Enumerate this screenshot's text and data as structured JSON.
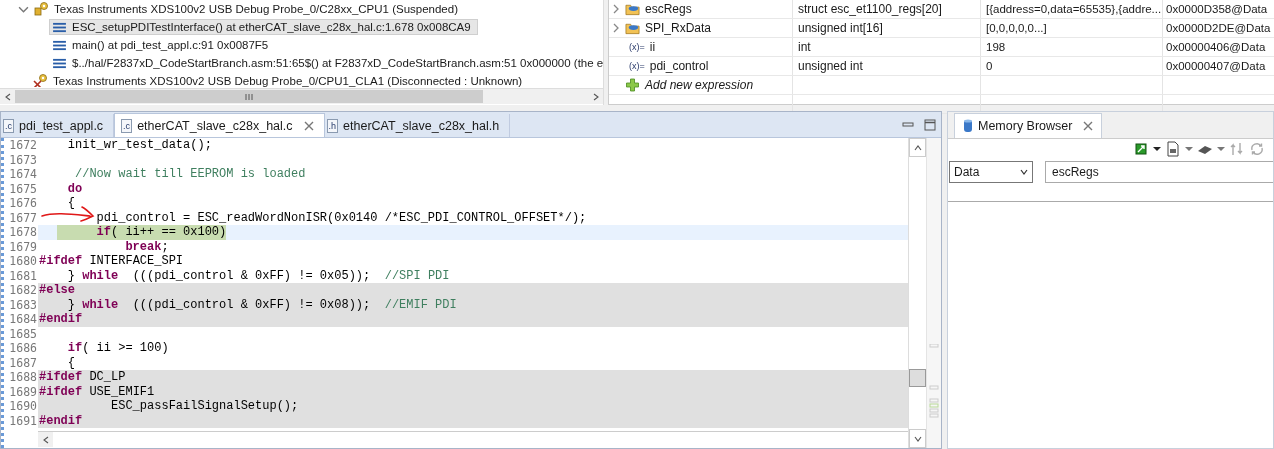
{
  "debug_tree": {
    "items": [
      {
        "kind": "target",
        "label": "Texas Instruments XDS100v2 USB Debug Probe_0/C28xx_CPU1 (Suspended)",
        "expanded": true,
        "children": [
          {
            "kind": "frame",
            "label": "ESC_setupPDITestInterface() at etherCAT_slave_c28x_hal.c:1.678 0x008CA9",
            "selected": true
          },
          {
            "kind": "frame",
            "label": "main() at pdi_test_appl.c:91 0x0087F5",
            "selected": false
          },
          {
            "kind": "frame",
            "label": "$../hal/F2837xD_CodeStartBranch.asm:51:65$() at F2837xD_CodeStartBranch.asm:51 0x000000  (the e",
            "selected": false
          }
        ]
      },
      {
        "kind": "disconnected",
        "label": "Texas Instruments XDS100v2 USB Debug Probe_0/CPU1_CLA1 (Disconnected : Unknown)"
      }
    ]
  },
  "expressions": {
    "rows": [
      {
        "kind": "struct",
        "name": "escRegs",
        "type": "struct esc_et1100_regs[20]",
        "value": "[{address=0,data=65535},{addre...",
        "address": "0x0000D358@Data",
        "expanded": false
      },
      {
        "kind": "struct",
        "name": "SPI_RxData",
        "type": "unsigned int[16]",
        "value": "[0,0,0,0,0...]",
        "address": "0x0000D2DE@Data",
        "expanded": false
      },
      {
        "kind": "variable",
        "symbol": "(x)=",
        "name": "ii",
        "type": "int",
        "value": "198",
        "address": "0x00000406@Data"
      },
      {
        "kind": "variable",
        "symbol": "(x)=",
        "name": "pdi_control",
        "type": "unsigned int",
        "value": "0",
        "address": "0x00000407@Data"
      },
      {
        "kind": "add",
        "name": "Add new expression"
      }
    ]
  },
  "editor": {
    "tabs": [
      {
        "label": "pdi_test_appl.c",
        "icon_text": ".c",
        "selected": false
      },
      {
        "label": "etherCAT_slave_c28x_hal.c",
        "icon_text": ".c",
        "selected": true
      },
      {
        "label": "etherCAT_slave_c28x_hal.h",
        "icon_text": ".h",
        "selected": false
      }
    ],
    "lines": [
      {
        "num": "1672",
        "segments": [
          {
            "kind": "plain",
            "text": "    init_wr_test_data();"
          }
        ]
      },
      {
        "num": "1673"
      },
      {
        "num": "1674",
        "segments": [
          {
            "kind": "comment",
            "text": "     //Now wait till EEPROM is loaded"
          }
        ]
      },
      {
        "num": "1675",
        "segments": [
          {
            "kind": "keyword",
            "text": "    do"
          }
        ]
      },
      {
        "num": "1676",
        "segments": [
          {
            "kind": "plain",
            "text": "    {"
          }
        ]
      },
      {
        "num": "1677",
        "segments": [
          {
            "kind": "plain",
            "text": "        pdi_control = ESC_readWordNonISR(0x0140 /*ESC_PDI_CONTROL_OFFSET*/);"
          }
        ]
      },
      {
        "num": "1678",
        "current": true,
        "segments": [
          {
            "kind": "keyword",
            "text": "        if"
          },
          {
            "kind": "plain",
            "text": "( ii++ == 0x100)"
          }
        ]
      },
      {
        "num": "1679",
        "segments": [
          {
            "kind": "keyword",
            "text": "            break"
          },
          {
            "kind": "plain",
            "text": ";"
          }
        ]
      },
      {
        "num": "1680",
        "segments": [
          {
            "kind": "preprocessor",
            "text": "#ifdef"
          },
          {
            "kind": "plain",
            "text": " INTERFACE_SPI"
          }
        ]
      },
      {
        "num": "1681",
        "segments": [
          {
            "kind": "plain",
            "text": "    } "
          },
          {
            "kind": "keyword",
            "text": "while"
          },
          {
            "kind": "plain",
            "text": "  (((pdi_control & 0xFF) != 0x05));  "
          },
          {
            "kind": "comment",
            "text": "//SPI PDI"
          }
        ]
      },
      {
        "num": "1682",
        "inactive": true,
        "segments": [
          {
            "kind": "preprocessor",
            "text": "#else"
          }
        ]
      },
      {
        "num": "1683",
        "inactive": true,
        "segments": [
          {
            "kind": "plain",
            "text": "    } "
          },
          {
            "kind": "keyword",
            "text": "while"
          },
          {
            "kind": "plain",
            "text": "  (((pdi_control & 0xFF) != 0x08));  "
          },
          {
            "kind": "comment",
            "text": "//EMIF PDI"
          }
        ]
      },
      {
        "num": "1684",
        "inactive": true,
        "segments": [
          {
            "kind": "preprocessor",
            "text": "#endif"
          }
        ]
      },
      {
        "num": "1685"
      },
      {
        "num": "1686",
        "segments": [
          {
            "kind": "keyword",
            "text": "    if"
          },
          {
            "kind": "plain",
            "text": "( ii >= 100)"
          }
        ]
      },
      {
        "num": "1687",
        "segments": [
          {
            "kind": "plain",
            "text": "    {"
          }
        ]
      },
      {
        "num": "1688",
        "inactive": true,
        "segments": [
          {
            "kind": "preprocessor",
            "text": "#ifdef"
          },
          {
            "kind": "plain",
            "text": " DC_LP"
          }
        ]
      },
      {
        "num": "1689",
        "inactive": true,
        "segments": [
          {
            "kind": "preprocessor",
            "text": "#ifdef"
          },
          {
            "kind": "plain",
            "text": " USE_EMIF1"
          }
        ]
      },
      {
        "num": "1690",
        "inactive": true,
        "segments": [
          {
            "kind": "plain",
            "text": "          ESC_passFailSignalSetup();"
          }
        ]
      },
      {
        "num": "1691",
        "inactive": true,
        "segments": [
          {
            "kind": "preprocessor",
            "text": "#endif"
          }
        ]
      }
    ]
  },
  "memory_browser": {
    "title": "Memory Browser",
    "space": "Data",
    "expression": "escRegs"
  }
}
